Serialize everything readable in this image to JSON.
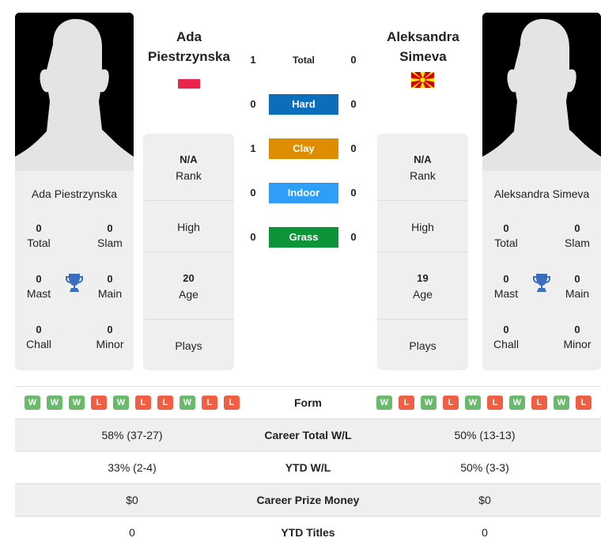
{
  "colors": {
    "hard": "#0a6ebd",
    "clay": "#de8d00",
    "indoor": "#2f9ef7",
    "grass": "#0e9438",
    "win": "#6ab96d",
    "loss": "#ef5f44",
    "trophy": "#3b6dbf",
    "card_bg": "#efefef"
  },
  "player1": {
    "name": "Ada Piestrzynska",
    "header_name_line1": "Ada",
    "header_name_line2": "Piestrzynska",
    "flag": "poland-flag",
    "titles": {
      "total": {
        "value": "0",
        "label": "Total"
      },
      "slam": {
        "value": "0",
        "label": "Slam"
      },
      "mast": {
        "value": "0",
        "label": "Mast"
      },
      "main": {
        "value": "0",
        "label": "Main"
      },
      "chall": {
        "value": "0",
        "label": "Chall"
      },
      "minor": {
        "value": "0",
        "label": "Minor"
      }
    },
    "info": {
      "rank": {
        "value": "N/A",
        "label": "Rank"
      },
      "high": {
        "label": "High"
      },
      "age": {
        "value": "20",
        "label": "Age"
      },
      "plays": {
        "label": "Plays"
      }
    },
    "form": [
      "W",
      "W",
      "W",
      "L",
      "W",
      "L",
      "L",
      "W",
      "L",
      "L"
    ]
  },
  "player2": {
    "name": "Aleksandra Simeva",
    "header_name_line1": "Aleksandra",
    "header_name_line2": "Simeva",
    "flag": "north-macedonia-flag",
    "titles": {
      "total": {
        "value": "0",
        "label": "Total"
      },
      "slam": {
        "value": "0",
        "label": "Slam"
      },
      "mast": {
        "value": "0",
        "label": "Mast"
      },
      "main": {
        "value": "0",
        "label": "Main"
      },
      "chall": {
        "value": "0",
        "label": "Chall"
      },
      "minor": {
        "value": "0",
        "label": "Minor"
      }
    },
    "info": {
      "rank": {
        "value": "N/A",
        "label": "Rank"
      },
      "high": {
        "label": "High"
      },
      "age": {
        "value": "19",
        "label": "Age"
      },
      "plays": {
        "label": "Plays"
      }
    },
    "form": [
      "W",
      "L",
      "W",
      "L",
      "W",
      "L",
      "W",
      "L",
      "W",
      "L"
    ]
  },
  "h2h": [
    {
      "label": "Total",
      "left": "1",
      "right": "0",
      "surface": "total"
    },
    {
      "label": "Hard",
      "left": "0",
      "right": "0",
      "surface": "hard"
    },
    {
      "label": "Clay",
      "left": "1",
      "right": "0",
      "surface": "clay"
    },
    {
      "label": "Indoor",
      "left": "0",
      "right": "0",
      "surface": "indoor"
    },
    {
      "label": "Grass",
      "left": "0",
      "right": "0",
      "surface": "grass"
    }
  ],
  "form_label": "Form",
  "stats": [
    {
      "label": "Career Total W/L",
      "left": "58% (37-27)",
      "right": "50% (13-13)"
    },
    {
      "label": "YTD W/L",
      "left": "33% (2-4)",
      "right": "50% (3-3)"
    },
    {
      "label": "Career Prize Money",
      "left": "$0",
      "right": "$0"
    },
    {
      "label": "YTD Titles",
      "left": "0",
      "right": "0"
    }
  ]
}
